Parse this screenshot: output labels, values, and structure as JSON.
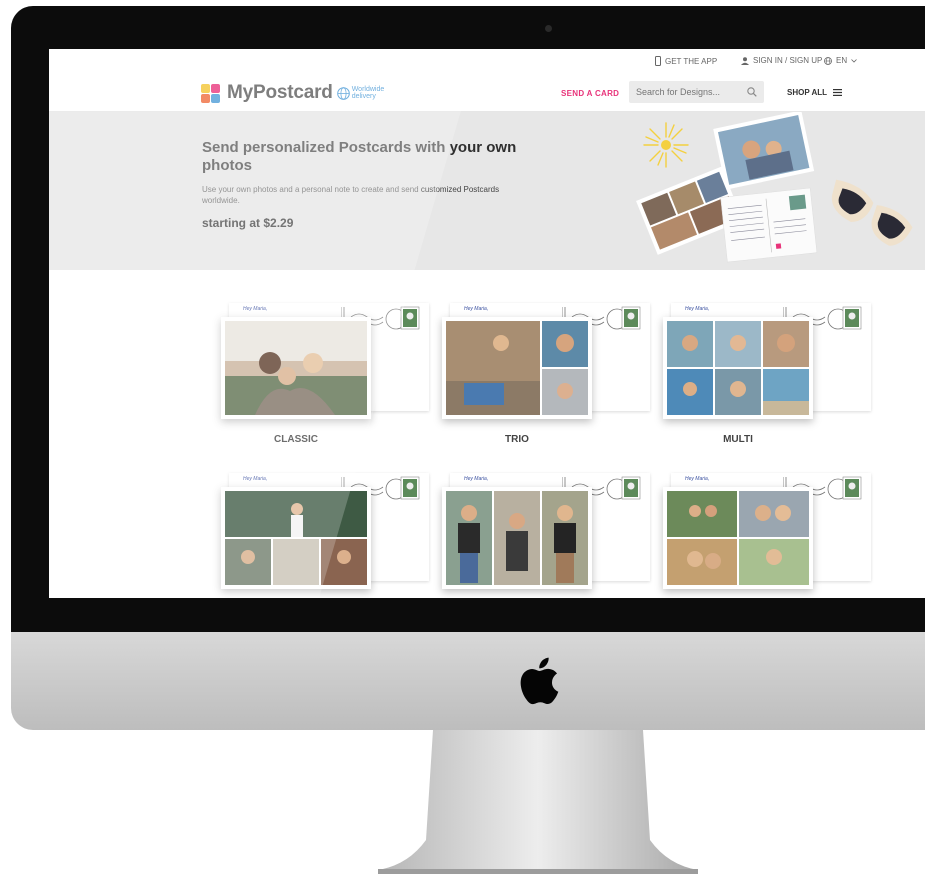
{
  "topbar": {
    "get_app": "GET THE APP",
    "sign_in": "SIGN IN / SIGN UP",
    "language": "EN",
    "logo": "MyPostcard",
    "badge_line1": "Worldwide",
    "badge_line2": "delivery",
    "send_card": "SEND A CARD",
    "search_placeholder": "Search for Designs...",
    "shop_all": "SHOP ALL"
  },
  "hero": {
    "title_part1": "Send personalized Postcards with ",
    "title_part2": "your own",
    "title_part3": "photos",
    "subtitle_part1": "Use your own photos and a personal note to create and send ",
    "subtitle_part2": "customized Postcards",
    "subtitle_part3": "worldwide.",
    "price": "starting at $2.29"
  },
  "cards": [
    {
      "label": "CLASSIC",
      "hey": "Hey Maria,"
    },
    {
      "label": "TRIO",
      "hey": "Hey Maria,"
    },
    {
      "label": "MULTI",
      "hey": "Hey Maria,"
    },
    {
      "label": "",
      "hey": "Hey Maria,"
    },
    {
      "label": "",
      "hey": "Hey Maria,"
    },
    {
      "label": "",
      "hey": "Hey Maria,"
    }
  ],
  "colors": {
    "accent": "#e8337a",
    "logo_text": "#5a5a5a",
    "badge": "#4a9ad6"
  }
}
